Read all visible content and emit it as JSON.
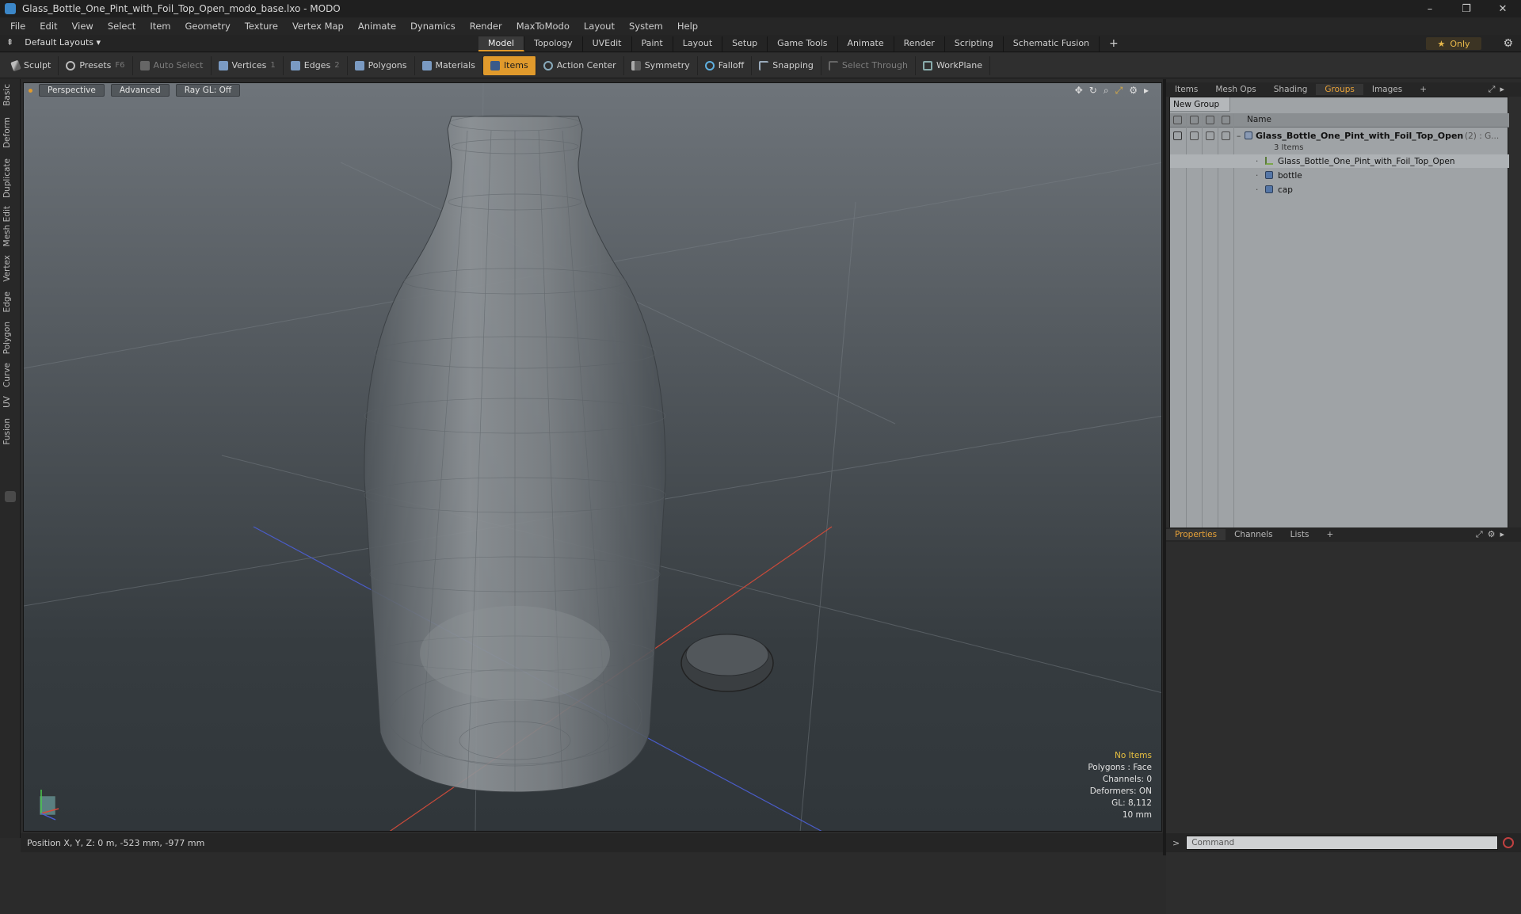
{
  "window": {
    "title": "Glass_Bottle_One_Pint_with_Foil_Top_Open_modo_base.lxo - MODO",
    "controls": [
      "–",
      "❐",
      "✕"
    ]
  },
  "menu": [
    "File",
    "Edit",
    "View",
    "Select",
    "Item",
    "Geometry",
    "Texture",
    "Vertex Map",
    "Animate",
    "Dynamics",
    "Render",
    "MaxToModo",
    "Layout",
    "System",
    "Help"
  ],
  "layout": {
    "selector": "Default Layouts ▾",
    "tabs": [
      "Model",
      "Topology",
      "UVEdit",
      "Paint",
      "Layout",
      "Setup",
      "Game Tools",
      "Animate",
      "Render",
      "Scripting",
      "Schematic Fusion"
    ],
    "active_tab": "Model",
    "add": "+",
    "only": "Only"
  },
  "toolbar": {
    "sculpt": "Sculpt",
    "presets": "Presets",
    "presets_key": "F6",
    "auto_select": "Auto Select",
    "vertices": "Vertices",
    "vertices_key": "1",
    "edges": "Edges",
    "edges_key": "2",
    "polygons": "Polygons",
    "materials": "Materials",
    "items": "Items",
    "action_center": "Action Center",
    "symmetry": "Symmetry",
    "falloff": "Falloff",
    "snapping": "Snapping",
    "select_through": "Select Through",
    "workplane": "WorkPlane"
  },
  "side_tabs": [
    "Basic",
    "Deform",
    "Duplicate",
    "Mesh Edit",
    "Vertex",
    "Edge",
    "Polygon",
    "Curve",
    "UV",
    "Fusion"
  ],
  "viewport": {
    "view": "Perspective",
    "shading": "Advanced",
    "raygl": "Ray GL: Off",
    "info": {
      "selection": "No Items",
      "polygons": "Polygons : Face",
      "channels": "Channels: 0",
      "deformers": "Deformers: ON",
      "gl": "GL: 8,112",
      "scale": "10 mm"
    }
  },
  "status": {
    "position": "Position X, Y, Z:  0 m, -523 mm, -977 mm"
  },
  "right_panel": {
    "tabs": [
      "Items",
      "Mesh Ops",
      "Shading",
      "Groups",
      "Images"
    ],
    "active_tab": "Groups",
    "new_group": "New Group",
    "name_header": "Name",
    "group": {
      "name": "Glass_Bottle_One_Pint_with_Foil_Top_Open",
      "suffix": "(2) : G...",
      "count": "3 Items",
      "children": [
        "Glass_Bottle_One_Pint_with_Foil_Top_Open",
        "bottle",
        "cap"
      ]
    }
  },
  "props_panel": {
    "tabs": [
      "Properties",
      "Channels",
      "Lists"
    ],
    "active_tab": "Properties"
  },
  "command": {
    "prompt": ">",
    "placeholder": "Command"
  },
  "colors": {
    "accent": "#e09a2c",
    "viewport_top": "#6e747a",
    "viewport_bottom": "#30363a"
  }
}
